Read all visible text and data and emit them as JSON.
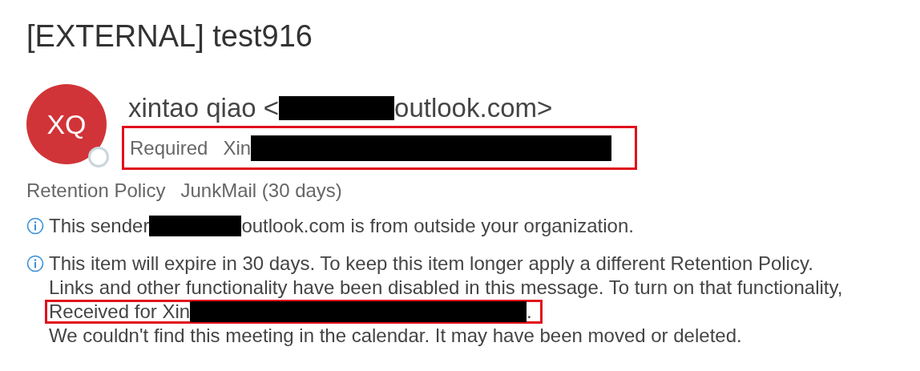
{
  "title": "[EXTERNAL] test916",
  "sender": {
    "initials": "XQ",
    "name_before": "xintao qiao <",
    "name_after": "outlook.com>",
    "redacted": true
  },
  "recipients": {
    "label": "Required",
    "name_start": "Xin",
    "redacted": true,
    "highlighted": true
  },
  "retention": {
    "label": "Retention Policy",
    "value": "JunkMail (30 days)"
  },
  "notices": [
    {
      "lines": [
        {
          "before": "This sender",
          "redacted": true,
          "after": "outlook.com is from outside your organization.",
          "highlighted": false
        }
      ]
    },
    {
      "lines": [
        {
          "before": "This item will expire in 30 days. To keep this item longer apply a different Retention Policy.",
          "redacted": false,
          "highlighted": false
        },
        {
          "before": "Links and other functionality have been disabled in this message. To turn on that functionality,",
          "redacted": false,
          "highlighted": false
        },
        {
          "before": "Received for Xin",
          "redacted": true,
          "after": ".",
          "highlighted": true
        },
        {
          "before": "We couldn't find this meeting in the calendar. It may have been moved or deleted.",
          "redacted": false,
          "highlighted": false
        }
      ]
    }
  ]
}
